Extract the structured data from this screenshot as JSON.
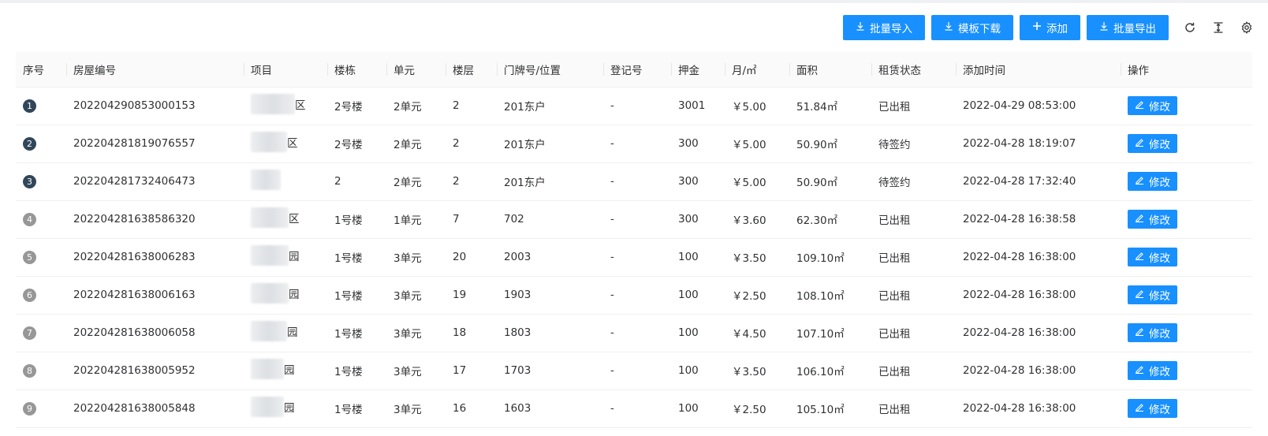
{
  "toolbar": {
    "buttons": [
      {
        "label": "批量导入",
        "icon": "download-icon"
      },
      {
        "label": "模板下载",
        "icon": "download-icon"
      },
      {
        "label": "添加",
        "icon": "plus-icon"
      },
      {
        "label": "批量导出",
        "icon": "download-icon"
      }
    ],
    "tools": [
      "refresh-icon",
      "column-height-icon",
      "settings-icon"
    ],
    "accent": "#1890ff"
  },
  "table": {
    "columns": [
      "序号",
      "房屋编号",
      "项目",
      "楼栋",
      "单元",
      "楼层",
      "门牌号/位置",
      "登记号",
      "押金",
      "月/㎡",
      "面积",
      "租赁状态",
      "添加时间",
      "操作"
    ],
    "action_label": "修改",
    "rows": [
      {
        "idx": "1",
        "house_no": "202204290853000153",
        "project": "区",
        "building": "2号楼",
        "unit": "2单元",
        "floor": "2",
        "location": "201东户",
        "reg_no": "-",
        "deposit": "3001",
        "price": "￥5.00",
        "area": "51.84㎡",
        "status": "已出租",
        "added": "2022-04-29 08:53:00"
      },
      {
        "idx": "2",
        "house_no": "202204281819076557",
        "project": "区",
        "building": "2号楼",
        "unit": "2单元",
        "floor": "2",
        "location": "201东户",
        "reg_no": "-",
        "deposit": "300",
        "price": "￥5.00",
        "area": "50.90㎡",
        "status": "待签约",
        "added": "2022-04-28 18:19:07"
      },
      {
        "idx": "3",
        "house_no": "202204281732406473",
        "project": "",
        "building": "2",
        "unit": "2单元",
        "floor": "2",
        "location": "201东户",
        "reg_no": "-",
        "deposit": "300",
        "price": "￥5.00",
        "area": "50.90㎡",
        "status": "待签约",
        "added": "2022-04-28 17:32:40"
      },
      {
        "idx": "4",
        "house_no": "202204281638586320",
        "project": "区",
        "building": "1号楼",
        "unit": "1单元",
        "floor": "7",
        "location": "702",
        "reg_no": "-",
        "deposit": "300",
        "price": "￥3.60",
        "area": "62.30㎡",
        "status": "已出租",
        "added": "2022-04-28 16:38:58"
      },
      {
        "idx": "5",
        "house_no": "202204281638006283",
        "project": "园",
        "building": "1号楼",
        "unit": "3单元",
        "floor": "20",
        "location": "2003",
        "reg_no": "-",
        "deposit": "100",
        "price": "￥3.50",
        "area": "109.10㎡",
        "status": "已出租",
        "added": "2022-04-28 16:38:00"
      },
      {
        "idx": "6",
        "house_no": "202204281638006163",
        "project": "园",
        "building": "1号楼",
        "unit": "3单元",
        "floor": "19",
        "location": "1903",
        "reg_no": "-",
        "deposit": "100",
        "price": "￥2.50",
        "area": "108.10㎡",
        "status": "已出租",
        "added": "2022-04-28 16:38:00"
      },
      {
        "idx": "7",
        "house_no": "202204281638006058",
        "project": "园",
        "building": "1号楼",
        "unit": "3单元",
        "floor": "18",
        "location": "1803",
        "reg_no": "-",
        "deposit": "100",
        "price": "￥4.50",
        "area": "107.10㎡",
        "status": "已出租",
        "added": "2022-04-28 16:38:00"
      },
      {
        "idx": "8",
        "house_no": "202204281638005952",
        "project": "园",
        "building": "1号楼",
        "unit": "3单元",
        "floor": "17",
        "location": "1703",
        "reg_no": "-",
        "deposit": "100",
        "price": "￥3.50",
        "area": "106.10㎡",
        "status": "已出租",
        "added": "2022-04-28 16:38:00"
      },
      {
        "idx": "9",
        "house_no": "202204281638005848",
        "project": "园",
        "building": "1号楼",
        "unit": "3单元",
        "floor": "16",
        "location": "1603",
        "reg_no": "-",
        "deposit": "100",
        "price": "￥2.50",
        "area": "105.10㎡",
        "status": "已出租",
        "added": "2022-04-28 16:38:00"
      }
    ]
  }
}
